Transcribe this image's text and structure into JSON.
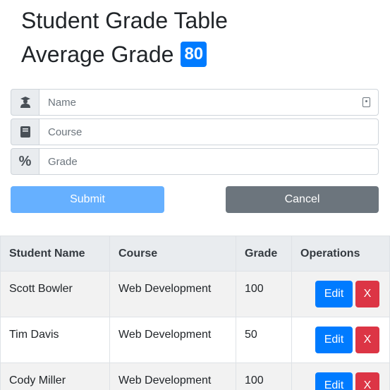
{
  "header": {
    "title": "Student Grade Table",
    "average_label": "Average Grade",
    "average_value": "80"
  },
  "form": {
    "name_placeholder": "Name",
    "course_placeholder": "Course",
    "grade_placeholder": "Grade",
    "grade_icon": "%",
    "submit_label": "Submit",
    "cancel_label": "Cancel"
  },
  "table": {
    "headers": [
      "Student Name",
      "Course",
      "Grade",
      "Operations"
    ],
    "rows": [
      {
        "name": "Scott Bowler",
        "course": "Web Development",
        "grade": "100",
        "edit": "Edit",
        "delete": "X"
      },
      {
        "name": "Tim Davis",
        "course": "Web Development",
        "grade": "50",
        "edit": "Edit",
        "delete": "X"
      },
      {
        "name": "Cody Miller",
        "course": "Web Development",
        "grade": "100",
        "edit": "Edit",
        "delete": "X"
      }
    ]
  },
  "colors": {
    "primary": "#007bff",
    "danger": "#dc3545",
    "secondary": "#6c757d",
    "submit_disabled": "#66b0ff"
  },
  "icons": [
    "graduate-icon",
    "book-icon",
    "percent-icon",
    "contact-card-icon"
  ]
}
